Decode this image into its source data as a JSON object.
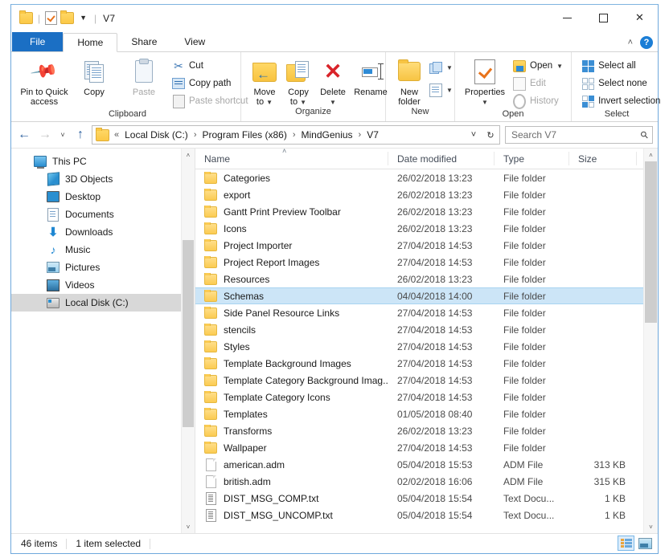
{
  "window": {
    "title": "V7",
    "quick_access": [
      "folder-icon",
      "properties-icon",
      "new-folder-icon",
      "dropdown-caret"
    ],
    "controls": {
      "minimize": "–",
      "maximize": "☐",
      "close": "✕"
    }
  },
  "ribbon": {
    "tabs": [
      {
        "label": "File",
        "active": false,
        "style": "file"
      },
      {
        "label": "Home",
        "active": true
      },
      {
        "label": "Share",
        "active": false
      },
      {
        "label": "View",
        "active": false
      }
    ],
    "collapse_chevron": "˄",
    "help_label": "?",
    "groups": [
      {
        "label": "Clipboard",
        "big_buttons": [
          {
            "label": "Pin to Quick\naccess",
            "line1": "Pin to Quick",
            "line2": "access",
            "disabled": false
          },
          {
            "label": "Copy",
            "line1": "Copy",
            "line2": "",
            "disabled": false
          },
          {
            "label": "Paste",
            "line1": "Paste",
            "line2": "",
            "disabled": true
          }
        ],
        "small_buttons": [
          {
            "label": "Cut",
            "disabled": false
          },
          {
            "label": "Copy path",
            "disabled": false
          },
          {
            "label": "Paste shortcut",
            "disabled": true
          }
        ]
      },
      {
        "label": "Organize",
        "big_buttons": [
          {
            "line1": "Move",
            "line2": "to",
            "caret": true
          },
          {
            "line1": "Copy",
            "line2": "to",
            "caret": true
          },
          {
            "line1": "Delete",
            "line2": "",
            "caret": true
          },
          {
            "line1": "Rename",
            "line2": "",
            "caret": false
          }
        ]
      },
      {
        "label": "New",
        "big_buttons": [
          {
            "line1": "New",
            "line2": "folder",
            "caret": false
          }
        ],
        "small_buttons": [
          {
            "label": "",
            "icon": "new-item-icon"
          },
          {
            "label": "",
            "icon": "easy-access-icon"
          }
        ]
      },
      {
        "label": "Open",
        "big_buttons": [
          {
            "line1": "Properties",
            "line2": "",
            "caret": true
          }
        ],
        "small_buttons": [
          {
            "label": "Open",
            "disabled": false,
            "caret": true
          },
          {
            "label": "Edit",
            "disabled": true
          },
          {
            "label": "History",
            "disabled": true
          }
        ]
      },
      {
        "label": "Select",
        "small_buttons": [
          {
            "label": "Select all",
            "disabled": false
          },
          {
            "label": "Select none",
            "disabled": false
          },
          {
            "label": "Invert selection",
            "disabled": false
          }
        ]
      }
    ]
  },
  "address_bar": {
    "back": "←",
    "forward": "→",
    "recent": "˅",
    "up": "↑",
    "overflow": "«",
    "breadcrumbs": [
      "Local Disk (C:)",
      "Program Files (x86)",
      "MindGenius",
      "V7"
    ],
    "separator": "›",
    "dropdown": "˅",
    "refresh": "↻"
  },
  "search": {
    "placeholder": "Search V7",
    "icon": "search-icon"
  },
  "sidebar": {
    "items": [
      {
        "label": "This PC",
        "icon": "pc-icon",
        "indent": 0,
        "selected": false
      },
      {
        "label": "3D Objects",
        "icon": "3d-objects-icon",
        "indent": 1,
        "selected": false
      },
      {
        "label": "Desktop",
        "icon": "desktop-icon",
        "indent": 1,
        "selected": false
      },
      {
        "label": "Documents",
        "icon": "documents-icon",
        "indent": 1,
        "selected": false
      },
      {
        "label": "Downloads",
        "icon": "downloads-icon",
        "indent": 1,
        "selected": false
      },
      {
        "label": "Music",
        "icon": "music-icon",
        "indent": 1,
        "selected": false
      },
      {
        "label": "Pictures",
        "icon": "pictures-icon",
        "indent": 1,
        "selected": false
      },
      {
        "label": "Videos",
        "icon": "videos-icon",
        "indent": 1,
        "selected": false
      },
      {
        "label": "Local Disk (C:)",
        "icon": "disk-icon",
        "indent": 1,
        "selected": true
      }
    ],
    "scroll": {
      "up": "˄",
      "down": "˅",
      "thumb_top_pct": 22,
      "thumb_height_pct": 52
    }
  },
  "file_list": {
    "columns": [
      {
        "label": "Name",
        "sorted": true,
        "sort_glyph": "˄"
      },
      {
        "label": "Date modified",
        "sorted": false
      },
      {
        "label": "Type",
        "sorted": false
      },
      {
        "label": "Size",
        "sorted": false
      }
    ],
    "rows": [
      {
        "name": "Categories",
        "date": "26/02/2018 13:23",
        "type": "File folder",
        "size": "",
        "icon": "folder-icon",
        "selected": false
      },
      {
        "name": "export",
        "date": "26/02/2018 13:23",
        "type": "File folder",
        "size": "",
        "icon": "folder-icon",
        "selected": false
      },
      {
        "name": "Gantt Print Preview Toolbar",
        "date": "26/02/2018 13:23",
        "type": "File folder",
        "size": "",
        "icon": "folder-icon",
        "selected": false
      },
      {
        "name": "Icons",
        "date": "26/02/2018 13:23",
        "type": "File folder",
        "size": "",
        "icon": "folder-icon",
        "selected": false
      },
      {
        "name": "Project Importer",
        "date": "27/04/2018 14:53",
        "type": "File folder",
        "size": "",
        "icon": "folder-icon",
        "selected": false
      },
      {
        "name": "Project Report Images",
        "date": "27/04/2018 14:53",
        "type": "File folder",
        "size": "",
        "icon": "folder-icon",
        "selected": false
      },
      {
        "name": "Resources",
        "date": "26/02/2018 13:23",
        "type": "File folder",
        "size": "",
        "icon": "folder-icon",
        "selected": false
      },
      {
        "name": "Schemas",
        "date": "04/04/2018 14:00",
        "type": "File folder",
        "size": "",
        "icon": "folder-icon",
        "selected": true
      },
      {
        "name": "Side Panel Resource Links",
        "date": "27/04/2018 14:53",
        "type": "File folder",
        "size": "",
        "icon": "folder-icon",
        "selected": false
      },
      {
        "name": "stencils",
        "date": "27/04/2018 14:53",
        "type": "File folder",
        "size": "",
        "icon": "folder-icon",
        "selected": false
      },
      {
        "name": "Styles",
        "date": "27/04/2018 14:53",
        "type": "File folder",
        "size": "",
        "icon": "folder-icon",
        "selected": false
      },
      {
        "name": "Template Background Images",
        "date": "27/04/2018 14:53",
        "type": "File folder",
        "size": "",
        "icon": "folder-icon",
        "selected": false
      },
      {
        "name": "Template Category Background Imag...",
        "date": "27/04/2018 14:53",
        "type": "File folder",
        "size": "",
        "icon": "folder-icon",
        "selected": false
      },
      {
        "name": "Template Category Icons",
        "date": "27/04/2018 14:53",
        "type": "File folder",
        "size": "",
        "icon": "folder-icon",
        "selected": false
      },
      {
        "name": "Templates",
        "date": "01/05/2018 08:40",
        "type": "File folder",
        "size": "",
        "icon": "folder-icon",
        "selected": false
      },
      {
        "name": "Transforms",
        "date": "26/02/2018 13:23",
        "type": "File folder",
        "size": "",
        "icon": "folder-icon",
        "selected": false
      },
      {
        "name": "Wallpaper",
        "date": "27/04/2018 14:53",
        "type": "File folder",
        "size": "",
        "icon": "folder-icon",
        "selected": false
      },
      {
        "name": "american.adm",
        "date": "05/04/2018 15:53",
        "type": "ADM File",
        "size": "313 KB",
        "icon": "adm-file-icon",
        "selected": false
      },
      {
        "name": "british.adm",
        "date": "02/02/2018 16:06",
        "type": "ADM File",
        "size": "315 KB",
        "icon": "adm-file-icon",
        "selected": false
      },
      {
        "name": "DIST_MSG_COMP.txt",
        "date": "05/04/2018 15:54",
        "type": "Text Docu...",
        "size": "1 KB",
        "icon": "text-file-icon",
        "selected": false
      },
      {
        "name": "DIST_MSG_UNCOMP.txt",
        "date": "05/04/2018 15:54",
        "type": "Text Docu...",
        "size": "1 KB",
        "icon": "text-file-icon",
        "selected": false
      }
    ],
    "scroll": {
      "up": "˄",
      "down": "˅",
      "thumb_top_pct": 0,
      "thumb_height_pct": 45
    }
  },
  "status_bar": {
    "item_count": "46 items",
    "selection": "1 item selected",
    "views": [
      {
        "name": "details-view",
        "active": true
      },
      {
        "name": "large-icons-view",
        "active": false
      }
    ]
  },
  "colors": {
    "accent": "#1b6fc4",
    "selection": "#cce5f7",
    "folder": "#fbcb52",
    "delete_red": "#d9242a"
  }
}
